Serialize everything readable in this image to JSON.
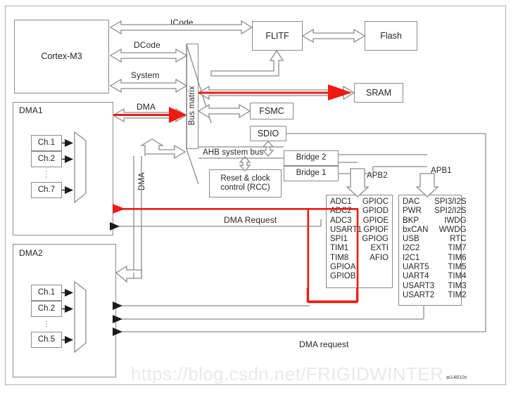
{
  "figure": {
    "id_code": "ai14810c",
    "watermark": "https://blog.csdn.net/FRIGIDWINTER",
    "accent_red": "#ee1b13",
    "line_gray": "#8b8b8b"
  },
  "blocks": {
    "cortex": "Cortex-M3",
    "flitf": "FLITF",
    "flash": "Flash",
    "sram": "SRAM",
    "fsmc": "FSMC",
    "sdio": "SDIO",
    "bus_matrix": "Bus matrix",
    "ahb_bus": "AHB system bus",
    "rcc": "Reset & clock\ncontrol (RCC)",
    "bridge2": "Bridge  2",
    "bridge1": "Bridge  1",
    "dma1": "DMA1",
    "dma2": "DMA2"
  },
  "bus_labels": {
    "icode": "ICode",
    "dcode": "DCode",
    "system": "System",
    "dma": "DMA",
    "dma_vertical": "DMA",
    "apb2": "APB2",
    "apb1": "APB1",
    "dma_request_upper": "DMA Request",
    "dma_request_lower": "DMA request"
  },
  "dma1_channels": {
    "first": "Ch.1",
    "second": "Ch.2",
    "last": "Ch.7",
    "ellipsis": "·\n·\n·"
  },
  "dma2_channels": {
    "first": "Ch.1",
    "second": "Ch.2",
    "last": "Ch.5",
    "ellipsis": "·\n·\n·"
  },
  "apb2_peripherals": {
    "left": [
      "ADC1",
      "ADC2",
      "ADC3",
      "USART1",
      "SPI1",
      "TIM1",
      "TIM8",
      "GPIOA",
      "GPIOB"
    ],
    "right": [
      "GPIOC",
      "GPIOD",
      "GPIOE",
      "GPIOF",
      "GPIOG",
      "EXTI",
      "AFIO"
    ]
  },
  "apb1_peripherals": {
    "left": [
      "DAC",
      "PWR",
      "BKP",
      "bxCAN",
      "USB",
      "I2C2",
      "I2C1",
      "UART5",
      "UART4",
      "USART3",
      "USART2"
    ],
    "right": [
      "SPI3/I2S",
      "SPI2/I2S",
      "IWDG",
      "WWDG",
      "RTC",
      "TIM7",
      "TIM6",
      "TIM5",
      "TIM4",
      "TIM3",
      "TIM2"
    ]
  }
}
